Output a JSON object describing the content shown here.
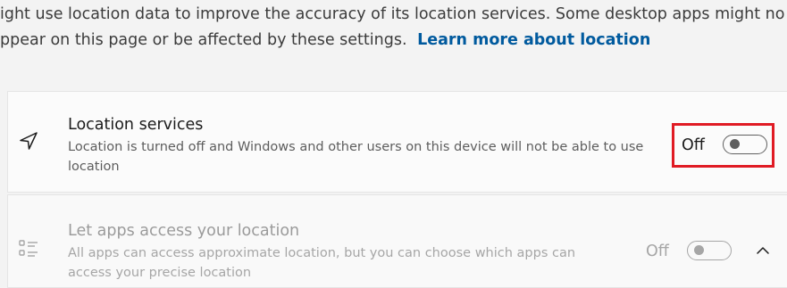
{
  "intro": {
    "line1": "ight use location data to improve the accuracy of its location services. Some desktop apps might no",
    "line2_text": "ppear on this page or be affected by these settings.",
    "learn_more": "Learn more about location"
  },
  "location_services": {
    "icon": "location-arrow-icon",
    "title": "Location services",
    "description": "Location is turned off and Windows and other users on this device will not be able to use location",
    "state_label": "Off",
    "enabled": false,
    "highlight_color": "#e01b24"
  },
  "app_access": {
    "icon": "list-icon",
    "title": "Let apps access your location",
    "description": "All apps can access approximate location, but you can choose which apps can access your precise location",
    "state_label": "Off",
    "enabled": false,
    "expand_icon": "chevron-up-icon"
  },
  "colors": {
    "link": "#005a9e",
    "background": "#f3f3f3",
    "card": "#fbfbfb"
  }
}
